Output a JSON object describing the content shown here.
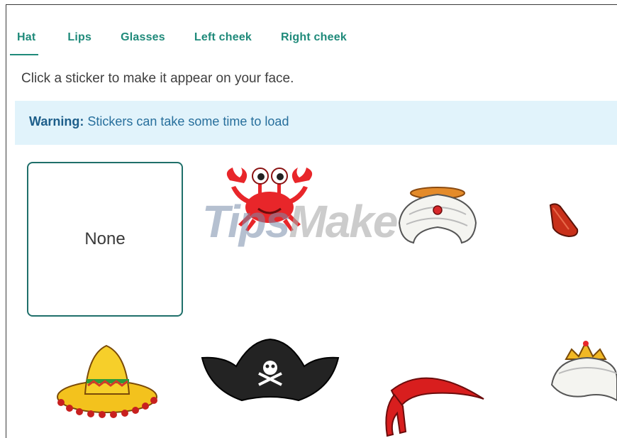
{
  "tabs": [
    {
      "label": "Hat",
      "active": true
    },
    {
      "label": "Lips",
      "active": false
    },
    {
      "label": "Glasses",
      "active": false
    },
    {
      "label": "Left cheek",
      "active": false
    },
    {
      "label": "Right cheek",
      "active": false
    }
  ],
  "instructions": "Click a sticker to make it appear on your face.",
  "warning": {
    "label": "Warning:",
    "text": " Stickers can take some time to load"
  },
  "stickers": {
    "none_label": "None",
    "items": [
      "crab",
      "turban",
      "party-hat",
      "sombrero",
      "pirate-hat",
      "bandana",
      "crown-turban"
    ]
  },
  "watermark": {
    "part1": "Tips",
    "part2": "Make"
  },
  "colors": {
    "accent": "#1f8a7a",
    "warning_bg": "#e1f3fb",
    "warning_text": "#276f9c",
    "selected_border": "#1f6f6a"
  }
}
